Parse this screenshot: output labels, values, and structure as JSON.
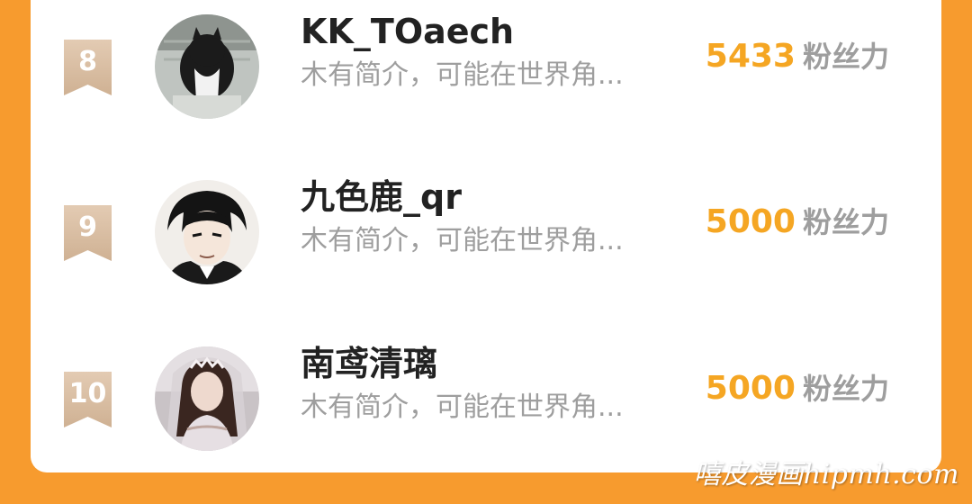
{
  "leaderboard": {
    "fans_label": "粉丝力",
    "rows": [
      {
        "rank": "8",
        "name": "KK_TOaech",
        "bio": "木有简介，可能在世界角...",
        "fans": "5433"
      },
      {
        "rank": "9",
        "name": "九色鹿_qr",
        "bio": "木有简介，可能在世界角...",
        "fans": "5000"
      },
      {
        "rank": "10",
        "name": "南鸢清璃",
        "bio": "木有简介，可能在世界角...",
        "fans": "5000"
      }
    ]
  },
  "watermark": "嘻皮漫画hipmh.com",
  "colors": {
    "background": "#F79B2E",
    "card": "#FFFFFF",
    "accent": "#F5A623",
    "rank_badge": "#D9BFA6",
    "name": "#222222",
    "secondary": "#9E9E9E"
  }
}
